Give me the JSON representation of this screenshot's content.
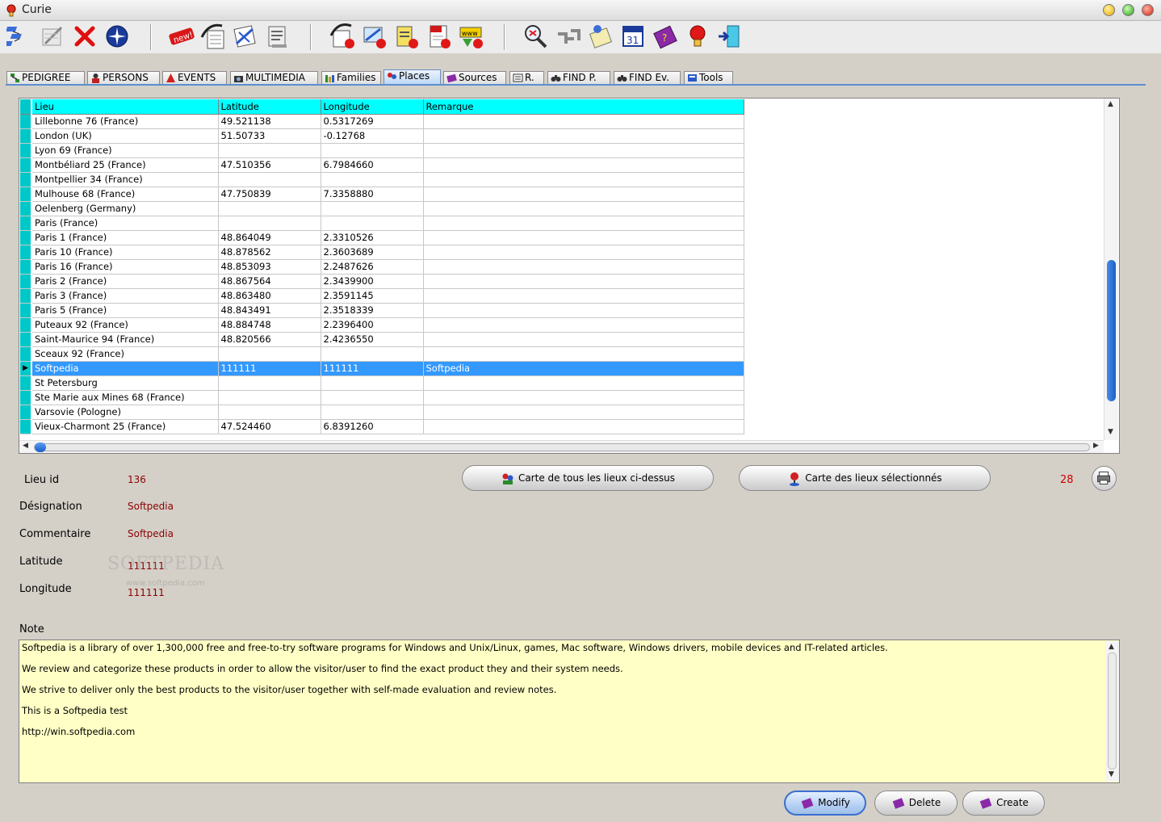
{
  "window": {
    "title": "Curie"
  },
  "toolbar": {
    "icons": [
      "tree-icon",
      "edit-icon",
      "delete-icon",
      "compass-icon",
      "new-icon",
      "gedcom-import-icon",
      "export-icon",
      "report-icon",
      "gedcom-export-icon",
      "web-export-icon",
      "book-export-icon",
      "pdf-export-icon",
      "www-icon",
      "search-icon",
      "relationship-icon",
      "notes-icon",
      "calendar-icon",
      "help-book-icon",
      "tip-icon",
      "exit-icon"
    ],
    "new_label": "new!",
    "calendar_day": "31"
  },
  "tabs": [
    {
      "label": "PEDIGREE",
      "active": false
    },
    {
      "label": "PERSONS",
      "active": false
    },
    {
      "label": "EVENTS",
      "active": false
    },
    {
      "label": "MULTIMEDIA",
      "active": false
    },
    {
      "label": "Families",
      "active": false
    },
    {
      "label": "Places",
      "active": true
    },
    {
      "label": "Sources",
      "active": false
    },
    {
      "label": "R.",
      "active": false
    },
    {
      "label": "FIND P.",
      "active": false
    },
    {
      "label": "FIND Ev.",
      "active": false
    },
    {
      "label": "Tools",
      "active": false
    }
  ],
  "grid": {
    "columns": [
      "Lieu",
      "Latitude",
      "Longitude",
      "Remarque"
    ],
    "rows": [
      [
        "Lillebonne 76 (France)",
        "49.521138",
        "0.5317269",
        ""
      ],
      [
        "London (UK)",
        "51.50733",
        "-0.12768",
        ""
      ],
      [
        "Lyon  69  (France)",
        "",
        "",
        ""
      ],
      [
        "Montbéliard 25 (France)",
        "47.510356",
        "6.7984660",
        ""
      ],
      [
        "Montpellier  34  (France)",
        "",
        "",
        ""
      ],
      [
        "Mulhouse 68 (France)",
        "47.750839",
        "7.3358880",
        ""
      ],
      [
        "Oelenberg (Germany)",
        "",
        "",
        ""
      ],
      [
        "Paris (France)",
        "",
        "",
        ""
      ],
      [
        "Paris 1 (France)",
        "48.864049",
        "2.3310526",
        ""
      ],
      [
        "Paris 10 (France)",
        "48.878562",
        "2.3603689",
        ""
      ],
      [
        "Paris 16 (France)",
        "48.853093",
        "2.2487626",
        ""
      ],
      [
        "Paris 2 (France)",
        "48.867564",
        "2.3439900",
        ""
      ],
      [
        "Paris 3 (France)",
        "48.863480",
        "2.3591145",
        ""
      ],
      [
        "Paris 5 (France)",
        "48.843491",
        "2.3518339",
        ""
      ],
      [
        "Puteaux 92 (France)",
        "48.884748",
        "2.2396400",
        ""
      ],
      [
        "Saint-Maurice 94 (France)",
        "48.820566",
        "2.4236550",
        ""
      ],
      [
        "Sceaux  92  (France)",
        "",
        "",
        ""
      ],
      [
        "Softpedia",
        "111111",
        "111111",
        "Softpedia"
      ],
      [
        "St Petersburg",
        "",
        "",
        ""
      ],
      [
        "Ste Marie aux Mines  68  (France)",
        "",
        "",
        ""
      ],
      [
        "Varsovie (Pologne)",
        "",
        "",
        ""
      ],
      [
        "Vieux-Charmont 25 (France)",
        "47.524460",
        "6.8391260",
        ""
      ]
    ],
    "selected_row": 17
  },
  "form": {
    "lieu_id_label": "Lieu id",
    "lieu_id": "136",
    "designation_label": "Désignation",
    "designation": "Softpedia",
    "commentaire_label": "Commentaire",
    "commentaire": "Softpedia",
    "latitude_label": "Latitude",
    "latitude": "111111",
    "longitude_label": "Longitude",
    "longitude": "111111"
  },
  "map_buttons": {
    "all_places": "Carte de tous les lieux ci-dessus",
    "selected_places": "Carte des lieux sélectionnés"
  },
  "count": "28",
  "watermark": {
    "text": "SOFTPEDIA",
    "sub": "www.softpedia.com"
  },
  "note": {
    "label": "Note",
    "lines": [
      "Softpedia is a library of over 1,300,000 free and free-to-try software programs for Windows and Unix/Linux, games, Mac software, Windows drivers, mobile devices and IT-related articles.",
      "We review and categorize these products in order to allow the visitor/user to find the exact product they and their system needs.",
      "We strive to deliver only the best products to the visitor/user together with self-made evaluation and review notes.",
      "This is a Softpedia test",
      "http://win.softpedia.com"
    ]
  },
  "actions": {
    "modify": "Modify",
    "delete": "Delete",
    "create": "Create"
  }
}
